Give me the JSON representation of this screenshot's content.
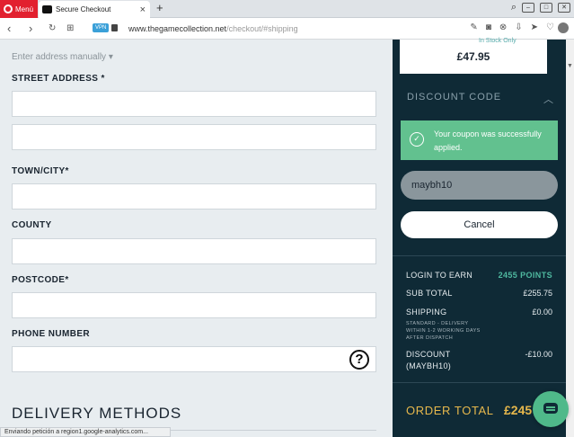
{
  "browser": {
    "menu_label": "Menú",
    "tab_title": "Secure Checkout",
    "tab_close": "×",
    "new_tab": "+",
    "vpn_badge": "VPN",
    "url_host": "www.thegamecollection.net",
    "url_path": "/checkout/#shipping",
    "status_tip": "Enviando petición a region1.google-analytics.com..."
  },
  "form": {
    "enter_manually": "Enter address manually ▾",
    "street_label": "STREET ADDRESS *",
    "town_label": "TOWN/CITY*",
    "county_label": "COUNTY",
    "postcode_label": "POSTCODE*",
    "phone_label": "PHONE NUMBER",
    "help_glyph": "?",
    "delivery_title": "DELIVERY METHODS"
  },
  "summary": {
    "stock_text": "In Stock Only",
    "item_price": "£47.95",
    "discount_heading": "DISCOUNT CODE",
    "coupon_success": "Your coupon was successfully applied.",
    "coupon_code": "maybh10",
    "cancel_label": "Cancel",
    "login_label": "LOGIN TO EARN",
    "login_points": "2455 POINTS",
    "subtotal_label": "SUB TOTAL",
    "subtotal_value": "£255.75",
    "shipping_label": "SHIPPING",
    "shipping_value": "£0.00",
    "shipping_note_1": "STANDARD - DELIVERY",
    "shipping_note_2": "WITHIN 1-2 WORKING DAYS",
    "shipping_note_3": "AFTER DISPATCH",
    "discount_label_1": "DISCOUNT",
    "discount_label_2": "(MAYBH10)",
    "discount_value": "-£10.00",
    "order_total_label": "ORDER TOTAL",
    "order_total_value": "£245"
  },
  "colors": {
    "accent_green": "#62c18f",
    "sidebar_bg": "#0f2a36",
    "total_gold": "#e7b84c",
    "points_teal": "#4fb9a0"
  }
}
